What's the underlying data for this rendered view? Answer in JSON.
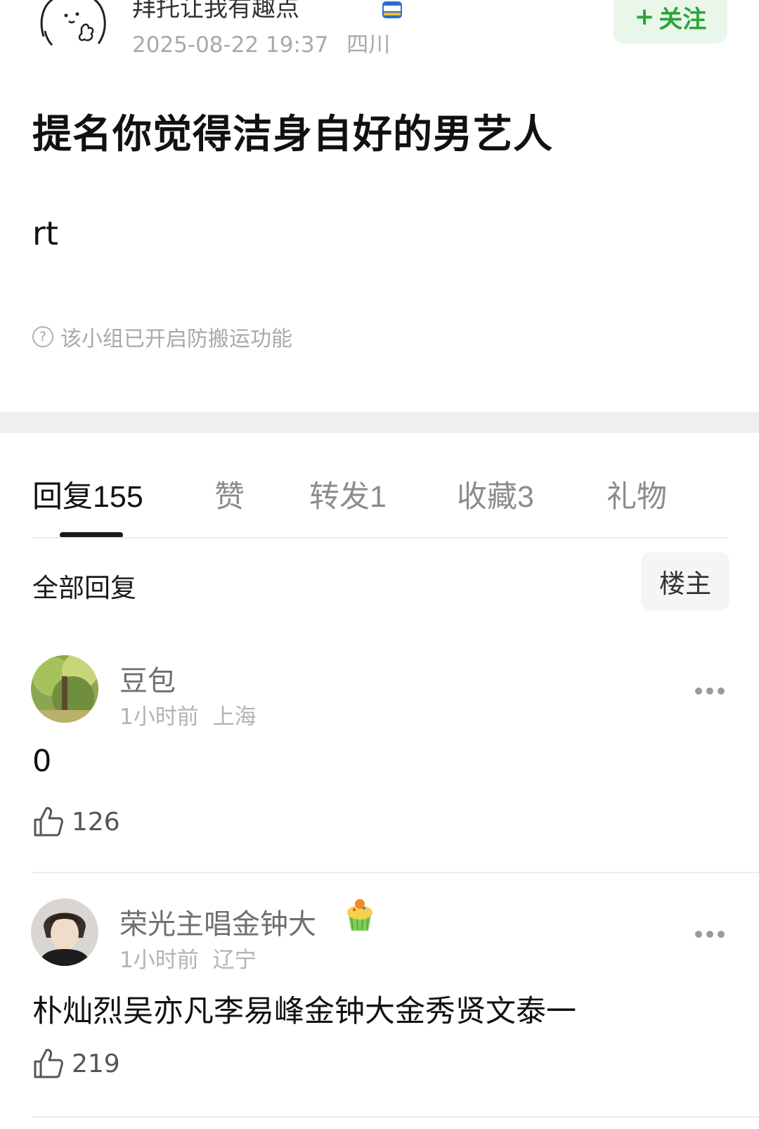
{
  "post": {
    "author_name": "拜托让我有趣点",
    "timestamp": "2025-08-22 19:37",
    "location": "四川",
    "follow_label": "关注",
    "follow_plus": "+",
    "title": "提名你觉得洁身自好的男艺人",
    "body": "rt",
    "anti_copy_notice": "该小组已开启防搬运功能"
  },
  "tabs": [
    {
      "label": "回复",
      "count": "155"
    },
    {
      "label": "赞",
      "count": ""
    },
    {
      "label": "转发",
      "count": "1"
    },
    {
      "label": "收藏",
      "count": "3"
    },
    {
      "label": "礼物",
      "count": ""
    }
  ],
  "replies_header": {
    "all_label": "全部回复",
    "op_filter_label": "楼主"
  },
  "comments": [
    {
      "username": "豆包",
      "time": "1小时前",
      "location": "上海",
      "text": "0",
      "likes": "126"
    },
    {
      "username": "荣光主唱金钟大",
      "time": "1小时前",
      "location": "辽宁",
      "text": "朴灿烈吴亦凡李易峰金钟大金秀贤文泰一",
      "likes": "219"
    }
  ],
  "colors": {
    "accent_green": "#2aa637",
    "follow_bg": "#eaf6ea",
    "meta_gray": "#a9a9a9"
  },
  "icons": [
    "author-avatar",
    "badge-icon",
    "question-icon",
    "more-icon",
    "thumbs-up-icon",
    "cupcake-icon"
  ]
}
